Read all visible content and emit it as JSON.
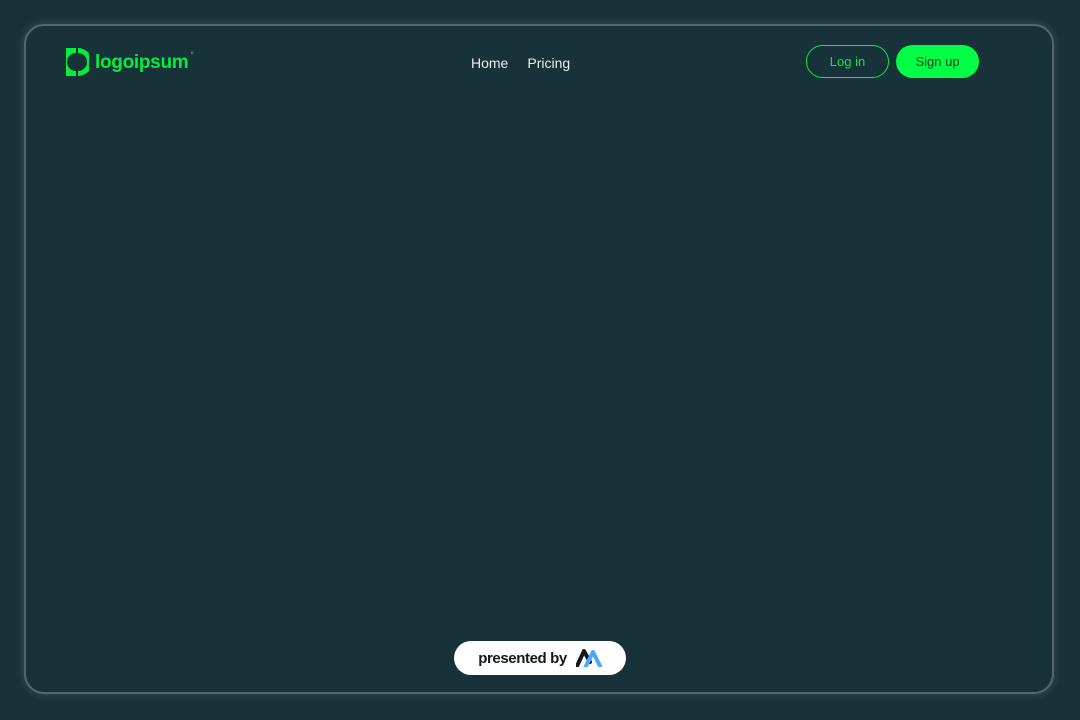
{
  "header": {
    "logo_text": "logoipsum",
    "logo_symbol": "°",
    "logo_icon": "logo-mark-icon"
  },
  "nav": {
    "items": [
      {
        "label": "Home"
      },
      {
        "label": "Pricing"
      }
    ]
  },
  "auth": {
    "login_label": "Log in",
    "signup_label": "Sign up"
  },
  "footer_badge": {
    "text": "presented by",
    "icon": "presenter-logo-icon"
  },
  "colors": {
    "background": "#173238",
    "accent": "#00ef3f",
    "signup_fill": "#00ff44",
    "nav_text": "#e9eeef",
    "badge_bg": "#ffffff"
  }
}
